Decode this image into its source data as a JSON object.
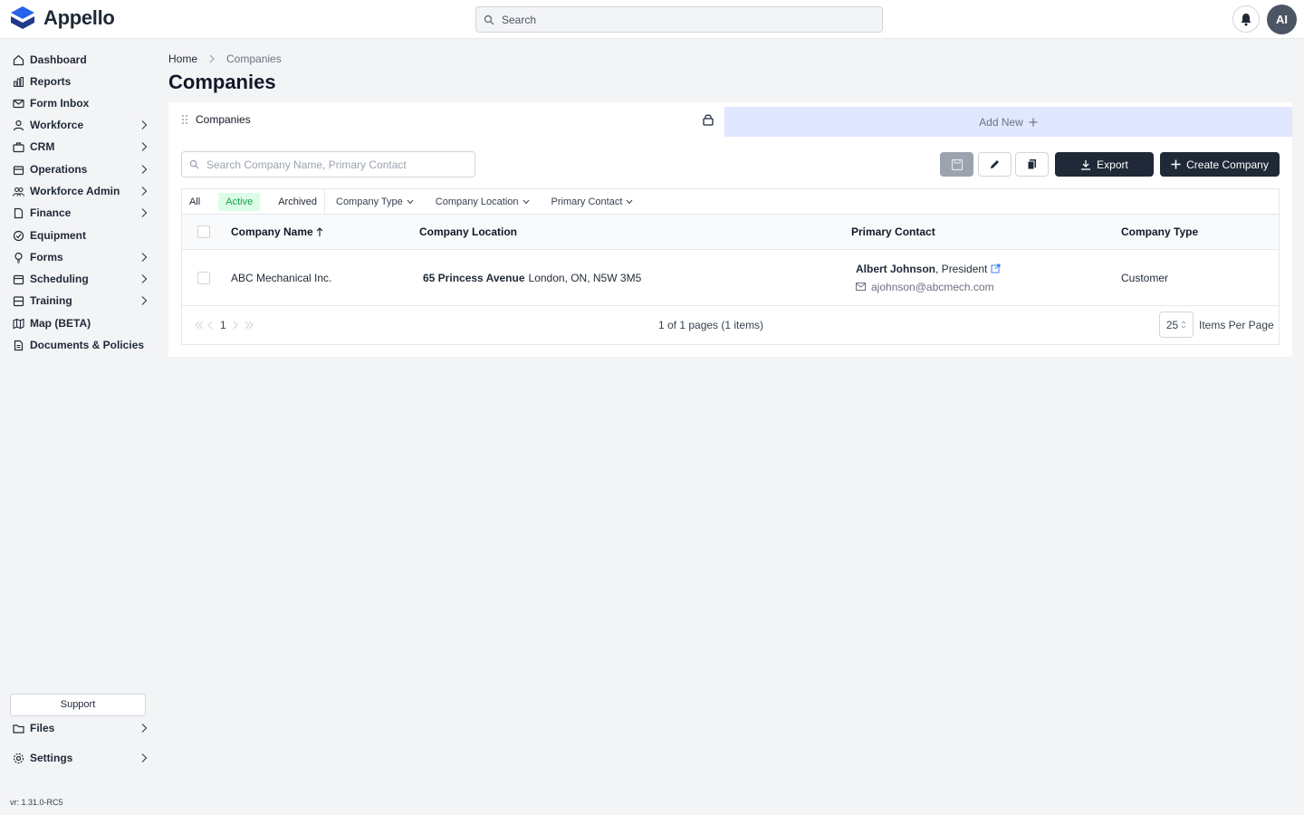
{
  "app": {
    "name": "Appello"
  },
  "topbar": {
    "search_placeholder": "Search",
    "avatar_initials": "AI"
  },
  "sidebar": {
    "items": [
      {
        "label": "Dashboard",
        "icon": "home-icon",
        "chevron": false
      },
      {
        "label": "Reports",
        "icon": "bar-chart-icon",
        "chevron": false
      },
      {
        "label": "Form Inbox",
        "icon": "mail-icon",
        "chevron": false
      },
      {
        "label": "Workforce",
        "icon": "user-icon",
        "chevron": true
      },
      {
        "label": "CRM",
        "icon": "briefcase-icon",
        "chevron": true
      },
      {
        "label": "Operations",
        "icon": "box-icon",
        "chevron": true
      },
      {
        "label": "Workforce Admin",
        "icon": "users-icon",
        "chevron": true
      },
      {
        "label": "Finance",
        "icon": "document-icon",
        "chevron": true
      },
      {
        "label": "Equipment",
        "icon": "check-circle-icon",
        "chevron": false
      },
      {
        "label": "Forms",
        "icon": "lightbulb-icon",
        "chevron": true
      },
      {
        "label": "Scheduling",
        "icon": "calendar-icon",
        "chevron": true
      },
      {
        "label": "Training",
        "icon": "layers-icon",
        "chevron": true
      },
      {
        "label": "Map (BETA)",
        "icon": "map-icon",
        "chevron": false
      },
      {
        "label": "Documents & Policies",
        "icon": "file-text-icon",
        "chevron": false
      }
    ],
    "support_label": "Support",
    "files_label": "Files",
    "settings_label": "Settings",
    "version": "vr: 1.31.0-RC5"
  },
  "breadcrumb": {
    "home": "Home",
    "current": "Companies"
  },
  "page": {
    "title": "Companies"
  },
  "tabs": {
    "active_label": "Companies",
    "add_label": "Add New"
  },
  "toolbar": {
    "search_placeholder": "Search Company Name, Primary Contact",
    "export_label": "Export",
    "create_label": "Create Company"
  },
  "filters": {
    "all": "All",
    "active": "Active",
    "archived": "Archived",
    "dropdowns": [
      "Company Type",
      "Company Location",
      "Primary Contact"
    ]
  },
  "table": {
    "columns": [
      "Company Name",
      "Company Location",
      "Primary Contact",
      "Company Type"
    ],
    "rows": [
      {
        "company_name": "ABC Mechanical Inc.",
        "location_street": "65 Princess Avenue",
        "location_city": "London, ON, N5W 3M5",
        "contact_name": "Albert Johnson",
        "contact_title": ", President",
        "contact_email": "ajohnson@abcmech.com",
        "company_type": "Customer"
      }
    ]
  },
  "pager": {
    "current_page": "1",
    "summary": "1 of 1 pages (1 items)",
    "per_page_value": "25",
    "per_page_label": "Items Per Page"
  },
  "colors": {
    "accent_dark": "#1f2937",
    "active_pill_bg": "#dcfce7",
    "active_pill_fg": "#16a34a",
    "add_tab_bg": "#e0e7ff"
  }
}
